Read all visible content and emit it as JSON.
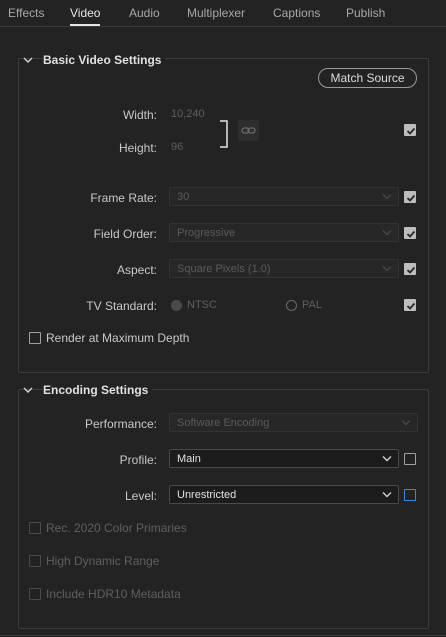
{
  "tabs": [
    "Effects",
    "Video",
    "Audio",
    "Multiplexer",
    "Captions",
    "Publish"
  ],
  "active_tab": "Video",
  "basic": {
    "title": "Basic Video Settings",
    "match_source": "Match Source",
    "width_label": "Width:",
    "width_value": "10,240",
    "height_label": "Height:",
    "height_value": "96",
    "frame_rate_label": "Frame Rate:",
    "frame_rate_value": "30",
    "field_order_label": "Field Order:",
    "field_order_value": "Progressive",
    "aspect_label": "Aspect:",
    "aspect_value": "Square Pixels (1.0)",
    "tv_standard_label": "TV Standard:",
    "ntsc": "NTSC",
    "pal": "PAL",
    "render_max_depth": "Render at Maximum Depth"
  },
  "encoding": {
    "title": "Encoding Settings",
    "performance_label": "Performance:",
    "performance_value": "Software Encoding",
    "profile_label": "Profile:",
    "profile_value": "Main",
    "level_label": "Level:",
    "level_value": "Unrestricted",
    "rec2020": "Rec. 2020 Color Primaries",
    "hdr": "High Dynamic Range",
    "hdr10": "Include HDR10 Metadata"
  },
  "colors": {
    "accent_blue": "#2d8ceb",
    "background": "#232323"
  }
}
